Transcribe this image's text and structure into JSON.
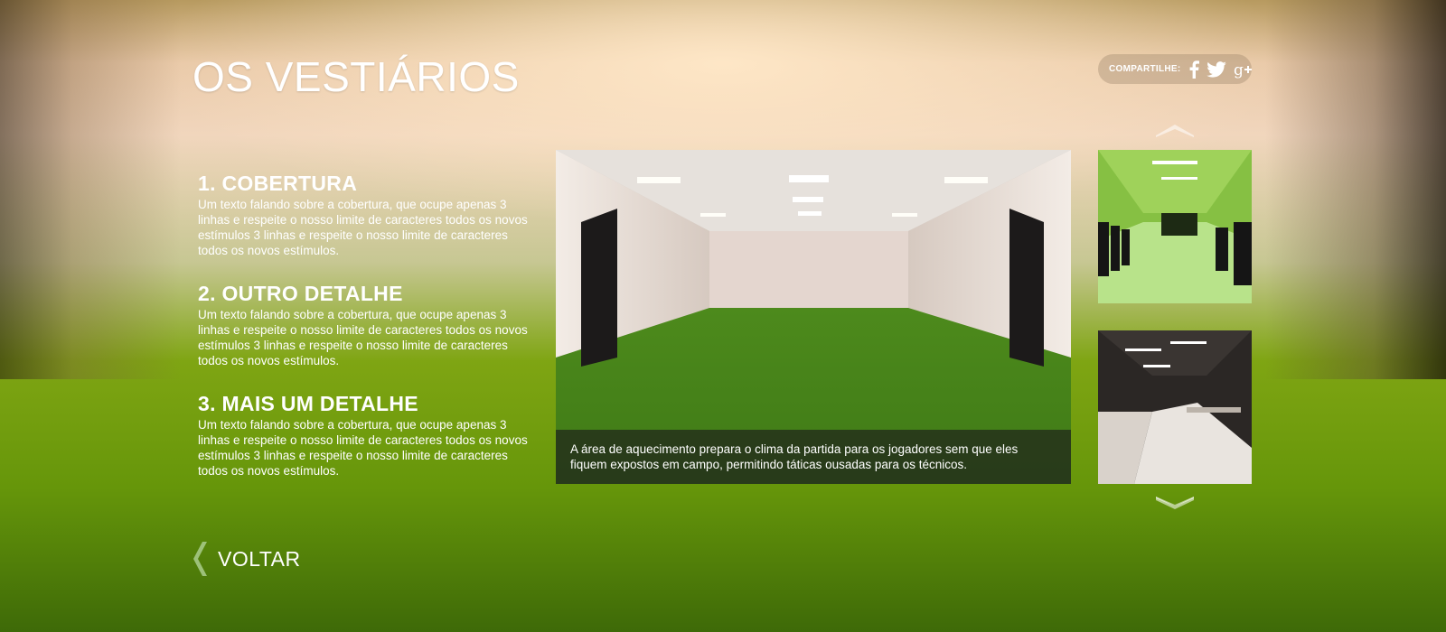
{
  "page": {
    "title": "OS VESTIÁRIOS"
  },
  "share": {
    "label": "COMPARTILHE:",
    "icons": [
      "facebook-icon",
      "twitter-icon",
      "google-plus-icon"
    ]
  },
  "details": [
    {
      "title": "1. COBERTURA",
      "text": "Um texto falando sobre a cobertura, que ocupe apenas 3 linhas e respeite o nosso limite de caracteres todos os novos estímulos 3 linhas e respeite o nosso limite de caracteres todos os novos estímulos."
    },
    {
      "title": "2. OUTRO DETALHE",
      "text": "Um texto falando sobre a cobertura, que ocupe apenas 3 linhas e respeite o nosso limite de caracteres todos os novos estímulos 3 linhas e respeite o nosso limite de caracteres todos os novos estímulos."
    },
    {
      "title": "3. MAIS UM DETALHE",
      "text": "Um texto falando sobre a cobertura, que ocupe apenas 3 linhas e respeite o nosso limite de caracteres todos os novos estímulos 3 linhas e respeite o nosso limite de caracteres todos os novos estímulos."
    }
  ],
  "gallery": {
    "caption": "A área de aquecimento prepara o clima da partida para os jogadores sem que eles fiquem expostos em campo, permitindo táticas ousadas para os técnicos."
  },
  "nav": {
    "back_label": "VOLTAR"
  },
  "colors": {
    "text": "#ffffff",
    "grass": "#5e9a1e",
    "caption_bg": "#1e1e1c"
  }
}
